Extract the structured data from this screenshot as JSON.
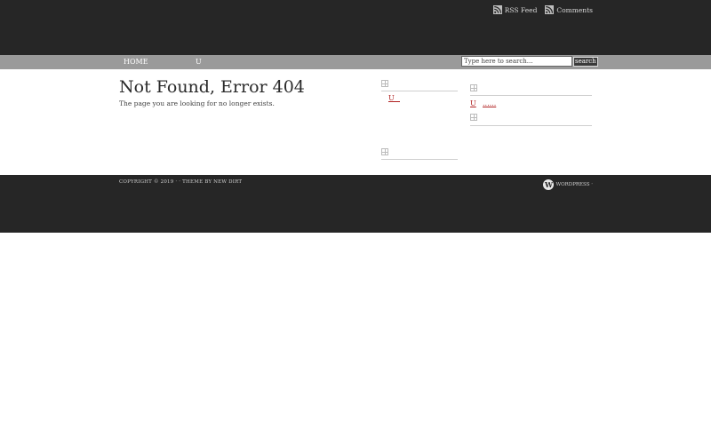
{
  "header": {
    "feeds": [
      {
        "label": "RSS Feed",
        "icon": "rss-icon"
      },
      {
        "label": "Comments",
        "icon": "rss-icon"
      }
    ]
  },
  "nav": {
    "items": [
      {
        "label": "HOME"
      },
      {
        "label": "U"
      }
    ],
    "search": {
      "placeholder": "Type here to search...",
      "button": "search"
    }
  },
  "main": {
    "title": "Not Found, Error 404",
    "text": "The page you are looking for no longer exists."
  },
  "sidebar_left": {
    "widgets": [
      {
        "icon": "widget-icon",
        "links": [
          "U"
        ]
      },
      {
        "icon": "widget-icon",
        "links": []
      }
    ]
  },
  "sidebar_right": {
    "widgets": [
      {
        "icon": "widget-icon",
        "links": [
          "U",
          "......"
        ]
      },
      {
        "icon": "widget-icon",
        "links": []
      }
    ]
  },
  "footer": {
    "copyright": "COPYRIGHT © 2019 ·  · THEME BY NEW DIRT",
    "wordpress": "WORDPRESS ·"
  },
  "colors": {
    "header_bg": "#262626",
    "nav_bg": "#9a9a9a",
    "link": "#b02020"
  }
}
